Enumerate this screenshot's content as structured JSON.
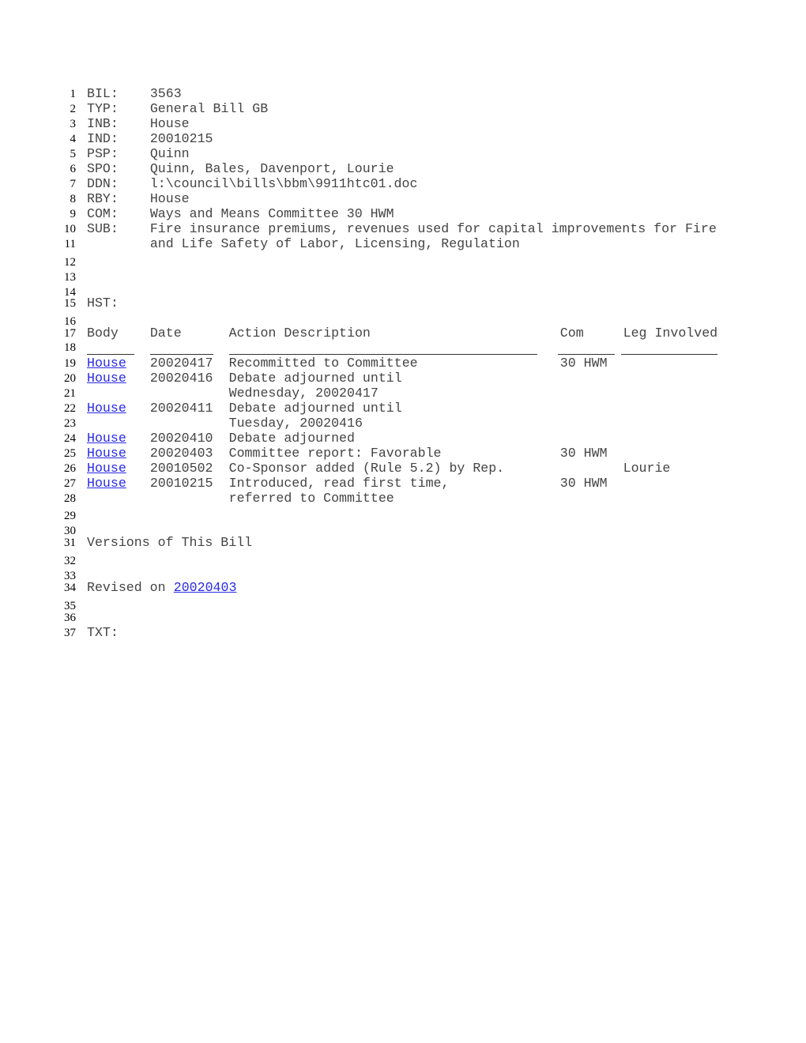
{
  "header_fields": [
    {
      "line": "1",
      "key": "BIL:",
      "value": "3563"
    },
    {
      "line": "2",
      "key": "TYP:",
      "value": "General Bill GB"
    },
    {
      "line": "3",
      "key": "INB:",
      "value": "House"
    },
    {
      "line": "4",
      "key": "IND:",
      "value": "20010215"
    },
    {
      "line": "5",
      "key": "PSP:",
      "value": "Quinn"
    },
    {
      "line": "6",
      "key": "SPO:",
      "value": "Quinn, Bales, Davenport, Lourie"
    },
    {
      "line": "7",
      "key": "DDN:",
      "value": "l:\\council\\bills\\bbm\\9911htc01.doc"
    },
    {
      "line": "8",
      "key": "RBY:",
      "value": "House"
    },
    {
      "line": "9",
      "key": "COM:",
      "value": "Ways and Means Committee 30 HWM"
    },
    {
      "line": "10",
      "key": "SUB:",
      "value": "Fire insurance premiums, revenues used for capital improvements for Fire"
    },
    {
      "line": "11",
      "key": "",
      "value": "and Life Safety of Labor, Licensing, Regulation"
    }
  ],
  "blank_lines": [
    "12",
    "13",
    "14",
    "16",
    "18",
    "29",
    "30",
    "32",
    "33",
    "35",
    "36"
  ],
  "history": {
    "line": "15",
    "label": "HST:",
    "header_line": "17",
    "columns": {
      "body": "Body",
      "date": "Date",
      "action": "Action Description",
      "com": "Com",
      "leg": "Leg Involved"
    },
    "rows": [
      {
        "line": "19",
        "body": "House",
        "date": "20020417",
        "action": "Recommitted to Committee",
        "com": "30 HWM",
        "leg": ""
      },
      {
        "line": "20",
        "body": "House",
        "date": "20020416",
        "action": "Debate adjourned until",
        "com": "",
        "leg": ""
      },
      {
        "line": "21",
        "body": "",
        "date": "",
        "action": "Wednesday, 20020417",
        "com": "",
        "leg": ""
      },
      {
        "line": "22",
        "body": "House",
        "date": "20020411",
        "action": "Debate adjourned until",
        "com": "",
        "leg": ""
      },
      {
        "line": "23",
        "body": "",
        "date": "",
        "action": "Tuesday, 20020416",
        "com": "",
        "leg": ""
      },
      {
        "line": "24",
        "body": "House",
        "date": "20020410",
        "action": "Debate adjourned",
        "com": "",
        "leg": ""
      },
      {
        "line": "25",
        "body": "House",
        "date": "20020403",
        "action": "Committee report: Favorable",
        "com": "30 HWM",
        "leg": ""
      },
      {
        "line": "26",
        "body": "House",
        "date": "20010502",
        "action": "Co-Sponsor added (Rule 5.2) by Rep.",
        "com": "",
        "leg": "Lourie"
      },
      {
        "line": "27",
        "body": "House",
        "date": "20010215",
        "action": "Introduced, read first time,",
        "com": "30 HWM",
        "leg": ""
      },
      {
        "line": "28",
        "body": "",
        "date": "",
        "action": "referred to Committee",
        "com": "",
        "leg": ""
      }
    ]
  },
  "versions": {
    "line": "31",
    "title": "Versions of This Bill",
    "revised_line": "34",
    "revised_prefix": "Revised on ",
    "revised_link": "20020403"
  },
  "text_section": {
    "line": "37",
    "label": "TXT:"
  },
  "colors": {
    "link": "#2a2ae8",
    "text": "#444444"
  }
}
